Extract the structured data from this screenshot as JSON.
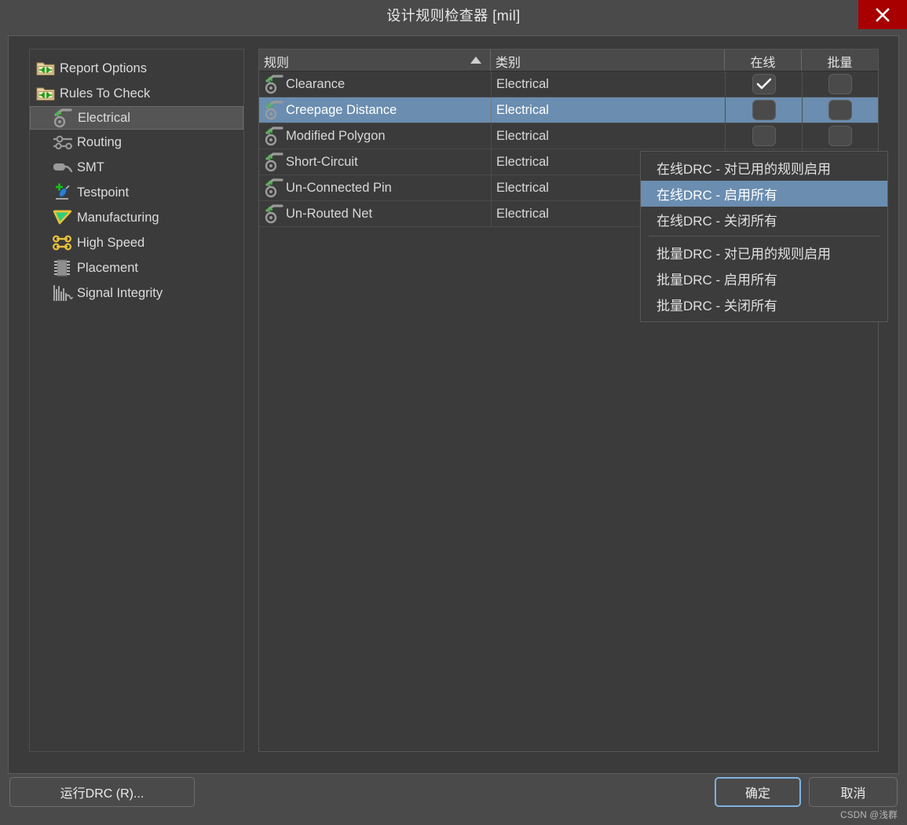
{
  "window": {
    "title": "设计规则检查器 [mil]",
    "close_icon": "close-icon"
  },
  "sidebar": {
    "items": [
      {
        "label": "Report Options",
        "icon": "folder-arrows-icon",
        "level": 0,
        "selected": false
      },
      {
        "label": "Rules To Check",
        "icon": "folder-arrows-icon",
        "level": 0,
        "selected": false
      },
      {
        "label": "Electrical",
        "icon": "electrical-rule-icon",
        "level": 1,
        "selected": true
      },
      {
        "label": "Routing",
        "icon": "routing-rule-icon",
        "level": 1,
        "selected": false
      },
      {
        "label": "SMT",
        "icon": "smt-rule-icon",
        "level": 1,
        "selected": false
      },
      {
        "label": "Testpoint",
        "icon": "testpoint-rule-icon",
        "level": 1,
        "selected": false
      },
      {
        "label": "Manufacturing",
        "icon": "manufacturing-rule-icon",
        "level": 1,
        "selected": false
      },
      {
        "label": "High Speed",
        "icon": "high-speed-rule-icon",
        "level": 1,
        "selected": false
      },
      {
        "label": "Placement",
        "icon": "placement-rule-icon",
        "level": 1,
        "selected": false
      },
      {
        "label": "Signal Integrity",
        "icon": "signal-integrity-rule-icon",
        "level": 1,
        "selected": false
      }
    ]
  },
  "table": {
    "columns": [
      {
        "key": "rule",
        "label": "规则",
        "sort": "asc"
      },
      {
        "key": "category",
        "label": "类别",
        "sort": "none"
      },
      {
        "key": "online",
        "label": "在线",
        "sort": "none"
      },
      {
        "key": "batch",
        "label": "批量",
        "sort": "none"
      }
    ],
    "sort_arrow_icon": "sort-ascending-icon",
    "rows": [
      {
        "rule": "Clearance",
        "category": "Electrical",
        "online": true,
        "batch": false,
        "selected": false,
        "icon": "electrical-rule-icon"
      },
      {
        "rule": "Creepage Distance",
        "category": "Electrical",
        "online": false,
        "batch": false,
        "selected": true,
        "icon": "electrical-rule-icon"
      },
      {
        "rule": "Modified Polygon",
        "category": "Electrical",
        "online": false,
        "batch": false,
        "selected": false,
        "icon": "electrical-rule-icon"
      },
      {
        "rule": "Short-Circuit",
        "category": "Electrical",
        "online": false,
        "batch": false,
        "selected": false,
        "icon": "electrical-rule-icon"
      },
      {
        "rule": "Un-Connected Pin",
        "category": "Electrical",
        "online": false,
        "batch": false,
        "selected": false,
        "icon": "electrical-rule-icon"
      },
      {
        "rule": "Un-Routed Net",
        "category": "Electrical",
        "online": false,
        "batch": false,
        "selected": false,
        "icon": "electrical-rule-icon"
      }
    ]
  },
  "context_menu": {
    "items": [
      {
        "label": "在线DRC - 对已用的规则启用",
        "highlighted": false,
        "separator_after": false
      },
      {
        "label": "在线DRC - 启用所有",
        "highlighted": true,
        "separator_after": false
      },
      {
        "label": "在线DRC - 关闭所有",
        "highlighted": false,
        "separator_after": true
      },
      {
        "label": "批量DRC - 对已用的规则启用",
        "highlighted": false,
        "separator_after": false
      },
      {
        "label": "批量DRC - 启用所有",
        "highlighted": false,
        "separator_after": false
      },
      {
        "label": "批量DRC - 关闭所有",
        "highlighted": false,
        "separator_after": false
      }
    ]
  },
  "footer": {
    "run_drc_label": "运行DRC (R)...",
    "ok_label": "确定",
    "cancel_label": "取消"
  },
  "watermark": "CSDN @浅群",
  "colors": {
    "window_bg": "#4a4a4a",
    "panel_bg": "#3b3b3b",
    "accent_selection": "#6a8db0",
    "close_red": "#a80000",
    "focus_blue": "#7fb0e0"
  }
}
